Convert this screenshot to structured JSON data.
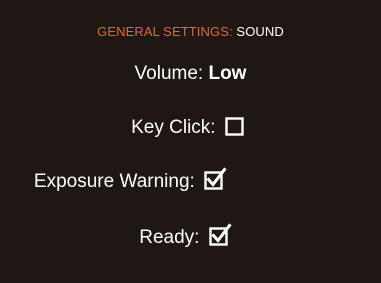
{
  "header": {
    "section": "GENERAL SETTINGS:",
    "page": "SOUND"
  },
  "colors": {
    "background": "#1e1714",
    "section_accent": "#e2673a",
    "text": "#ffffff"
  },
  "settings": {
    "volume": {
      "label": "Volume:",
      "value": "Low"
    },
    "key_click": {
      "label": "Key Click:",
      "checked": false,
      "icon": "checkbox-unchecked-icon"
    },
    "exposure_warning": {
      "label": "Exposure Warning:",
      "checked": true,
      "icon": "checkbox-checked-icon"
    },
    "ready": {
      "label": "Ready:",
      "checked": true,
      "icon": "checkbox-checked-icon"
    }
  }
}
